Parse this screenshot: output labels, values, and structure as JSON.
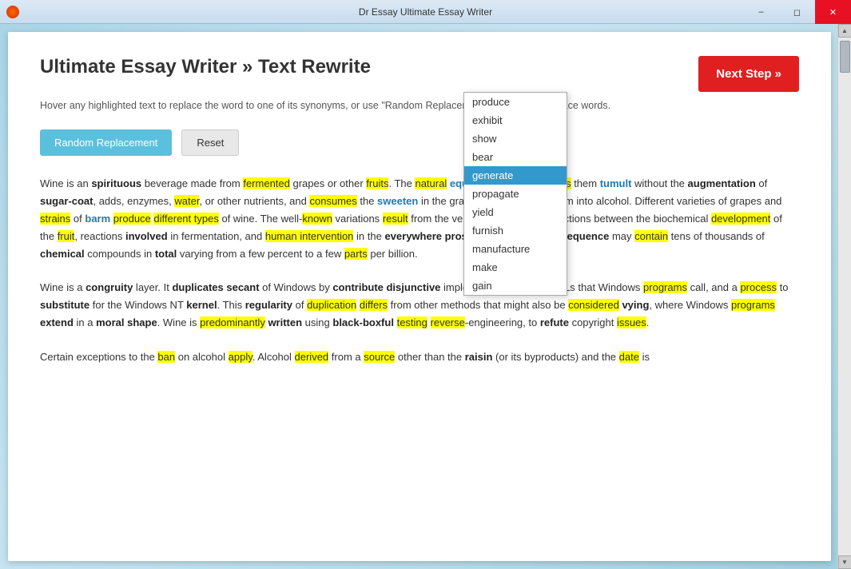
{
  "window": {
    "title": "Dr Essay Ultimate Essay Writer",
    "controls": {
      "minimize": "–",
      "restore": "◻",
      "close": "✕"
    }
  },
  "header": {
    "title": "Ultimate Essay Writer » Text Rewrite",
    "subtitle": "Hover any highlighted text to replace the word to one of its synonyms, or use \"Random Replacement\" to randomly replace words.",
    "next_step_label": "Next Step »"
  },
  "buttons": {
    "random_replacement": "Random Replacement",
    "reset": "Reset"
  },
  "dropdown": {
    "items": [
      {
        "label": "produce",
        "selected": false
      },
      {
        "label": "exhibit",
        "selected": false
      },
      {
        "label": "show",
        "selected": false
      },
      {
        "label": "bear",
        "selected": false
      },
      {
        "label": "generate",
        "selected": true
      },
      {
        "label": "propagate",
        "selected": false
      },
      {
        "label": "yield",
        "selected": false
      },
      {
        "label": "furnish",
        "selected": false
      },
      {
        "label": "manufacture",
        "selected": false
      },
      {
        "label": "make",
        "selected": false
      },
      {
        "label": "gain",
        "selected": false
      }
    ]
  },
  "paragraphs": [
    {
      "id": "p1",
      "text": "Wine is an spirituous beverage made from fermented grapes or other fruits. The natural equilibrium of grapes lets them tumult without the augmentation of sugar-coat, adds, enzymes, water, or other nutrients, and consumes the sweeten in the grapes and translate them into alcohol. Different varieties of grapes and strains of barm produce different types of wine. The well-known variations result from the very complicated interactions between the biochemical development of the fruit, reactions involved in fermentation, and human intervention in the everywhere prosecute. The final consequence may contain tens of thousands of chemical compounds in total varying from a few percent to a few parts per billion."
    },
    {
      "id": "p2",
      "text": "Wine is a congruity layer. It duplicates secant of Windows by contribute disjunctive implementations of the DLLs that Windows programs call, and a process to substitute for the Windows NT kernel. This regularity of duplication differs from other methods that might also be considered vying, where Windows programs extend in a moral shape. Wine is predominantly written using black-boxful testing reverse-engineering, to refute copyright issues."
    },
    {
      "id": "p3",
      "text": "Certain exceptions to the ban on alcohol apply. Alcohol derived from a source other than the raisin (or its byproducts) and the date is"
    }
  ]
}
